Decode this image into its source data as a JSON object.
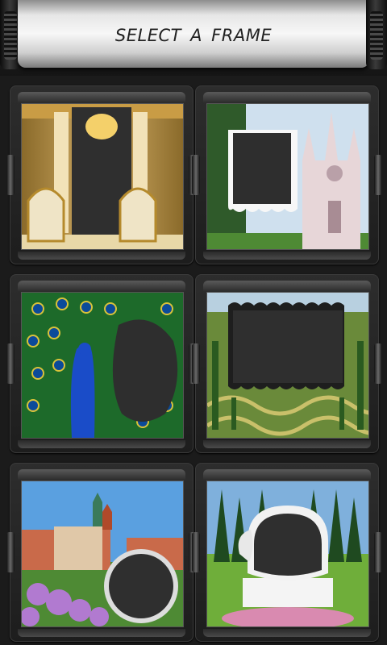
{
  "header": {
    "title": "SELECT  A FRAME"
  },
  "frames": [
    {
      "name": "palace-chairs-frame"
    },
    {
      "name": "gothic-church-frame"
    },
    {
      "name": "peacock-frame"
    },
    {
      "name": "garden-maze-frame"
    },
    {
      "name": "castle-flowers-frame"
    },
    {
      "name": "park-monument-frame"
    }
  ]
}
